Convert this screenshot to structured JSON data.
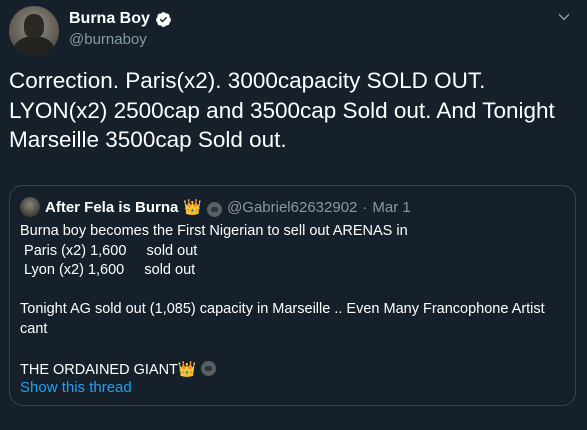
{
  "author": {
    "name": "Burna Boy",
    "handle": "@burnaboy",
    "verified_icon": "verified-badge-icon"
  },
  "tweet": {
    "lines": [
      "Correction. Paris(x2). 3000capacity SOLD OUT.",
      "LYON(x2) 2500cap and 3500cap Sold out. And Tonight",
      "Marseille 3500cap Sold out."
    ]
  },
  "quoted_tweet": {
    "author_name": "After Fela is Burna",
    "name_emoji_1": "👑",
    "name_emoji_2": "gorilla-icon",
    "handle": "@Gabriel62632902",
    "separator": "·",
    "date": "Mar 1",
    "body": {
      "line1": "Burna boy becomes the First Nigerian to sell out ARENAS in",
      "line2": " Paris (x2) 1,600     sold out",
      "line3": " Lyon (x2) 1,600     sold out",
      "line4": "Tonight AG sold out (1,085) capacity in Marseille .. Even Many Francophone Artist",
      "line5": "cant",
      "line6": "THE ORDAINED GIANT",
      "line6_emoji": "👑"
    },
    "show_thread_label": "Show this thread"
  },
  "colors": {
    "background": "#15202b",
    "text_primary": "#ffffff",
    "text_secondary": "#8899a6",
    "link": "#1da1f2",
    "border": "#38444d"
  }
}
